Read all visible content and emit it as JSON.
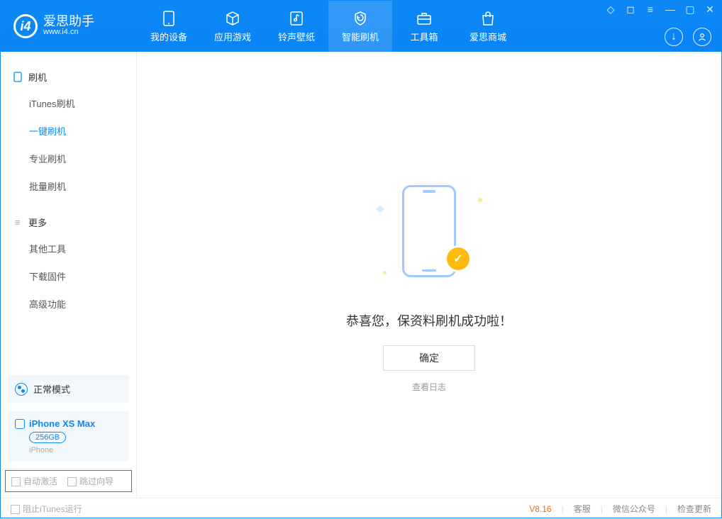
{
  "app": {
    "name_cn": "爱思助手",
    "name_en": "www.i4.cn"
  },
  "header": {
    "tabs": [
      {
        "label": "我的设备"
      },
      {
        "label": "应用游戏"
      },
      {
        "label": "铃声壁纸"
      },
      {
        "label": "智能刷机"
      },
      {
        "label": "工具箱"
      },
      {
        "label": "爱思商城"
      }
    ]
  },
  "sidebar": {
    "group1_title": "刷机",
    "group1_items": [
      "iTunes刷机",
      "一键刷机",
      "专业刷机",
      "批量刷机"
    ],
    "group2_title": "更多",
    "group2_items": [
      "其他工具",
      "下载固件",
      "高级功能"
    ],
    "mode_label": "正常模式",
    "device": {
      "name": "iPhone XS Max",
      "capacity": "256GB",
      "type": "iPhone"
    },
    "opt_auto_activate": "自动激活",
    "opt_skip_guide": "跳过向导"
  },
  "main": {
    "success_message": "恭喜您，保资料刷机成功啦！",
    "ok_button": "确定",
    "view_log": "查看日志"
  },
  "footer": {
    "block_itunes": "阻止iTunes运行",
    "version": "V8.16",
    "cs": "客服",
    "wechat": "微信公众号",
    "update": "检查更新"
  }
}
